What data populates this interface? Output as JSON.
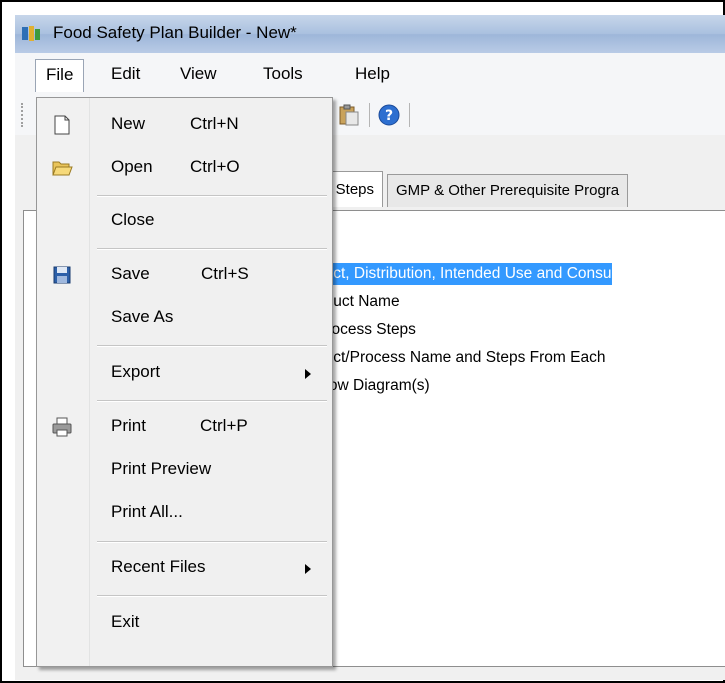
{
  "window": {
    "title": "Food Safety Plan Builder - New*"
  },
  "menubar": {
    "items": [
      "File",
      "Edit",
      "View",
      "Tools",
      "Help"
    ]
  },
  "tabs": [
    {
      "label": "y Steps"
    },
    {
      "label": "GMP & Other Prerequisite Progra"
    }
  ],
  "tree": {
    "items": [
      "duct, Distribution, Intended Use and Consu",
      "oduct Name",
      "Process Steps",
      "duct/Process Name and Steps From Each",
      "Flow Diagram(s)"
    ]
  },
  "file_menu": {
    "new": {
      "label": "New",
      "shortcut": "Ctrl+N",
      "icon": "new-document-icon"
    },
    "open": {
      "label": "Open",
      "shortcut": "Ctrl+O",
      "icon": "open-folder-icon"
    },
    "close": {
      "label": "Close"
    },
    "save": {
      "label": "Save",
      "shortcut": "Ctrl+S",
      "icon": "floppy-disk-icon"
    },
    "save_as": {
      "label": "Save As"
    },
    "export": {
      "label": "Export"
    },
    "print": {
      "label": "Print",
      "shortcut": "Ctrl+P",
      "icon": "printer-icon"
    },
    "print_preview": {
      "label": "Print Preview"
    },
    "print_all": {
      "label": "Print All..."
    },
    "recent_files": {
      "label": "Recent Files"
    },
    "exit": {
      "label": "Exit"
    }
  },
  "colors": {
    "selection": "#3399ff",
    "titlebar": "#a9c0df"
  }
}
